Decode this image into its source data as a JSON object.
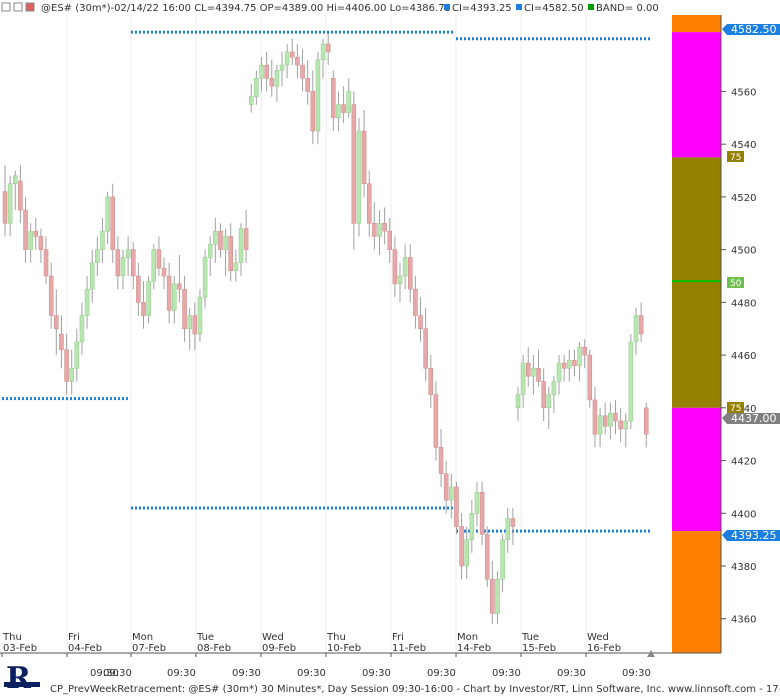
{
  "header": {
    "symbol_line": "@ES# (30m*)-02/14/22 16:00 CL=4394.75 OP=4389.00 Hi=4406.00 Lo=4386.75",
    "ci_upper": "CI=4393.25",
    "ci_lower": "CI=4582.50",
    "band": "BAND= 0.00"
  },
  "footer": {
    "status": "CP_PrevWeekRetracement: @ES# (30m*) 30 Minutes*, Day Session 09:30-16:00 - Chart by Investor/RT, Linn Software, Inc. www.linnsoft.com - 17-Fe"
  },
  "price_labels": {
    "top_level": "4582.50",
    "current": "4437.00",
    "bottom_level": "4393.25",
    "pct_75_upper": "75",
    "pct_50": "50",
    "pct_75_lower": "75"
  },
  "colors": {
    "up_candle": "#b8e6b0",
    "down_candle": "#e6a8a8",
    "dotted_level": "#1a7fe0",
    "band_orange": "#ff8000",
    "band_magenta": "#ff00ff",
    "band_olive": "#958000",
    "line_50": "#00c000",
    "current_label": "#808080"
  },
  "chart_data": {
    "type": "candlestick",
    "ylim": [
      4347,
      4589
    ],
    "y_ticks": [
      4360,
      4380,
      4400,
      4420,
      4440,
      4460,
      4480,
      4500,
      4520,
      4540,
      4560
    ],
    "x_labels": [
      {
        "day": "Thu",
        "date": "03-Feb"
      },
      {
        "day": "Fri",
        "date": "04-Feb"
      },
      {
        "day": "Mon",
        "date": "07-Feb"
      },
      {
        "day": "Tue",
        "date": "08-Feb"
      },
      {
        "day": "Wed",
        "date": "09-Feb"
      },
      {
        "day": "Thu",
        "date": "10-Feb"
      },
      {
        "day": "Fri",
        "date": "11-Feb"
      },
      {
        "day": "Mon",
        "date": "14-Feb"
      },
      {
        "day": "Tue",
        "date": "15-Feb"
      },
      {
        "day": "Wed",
        "date": "16-Feb"
      }
    ],
    "session_label": "09:30",
    "levels": [
      {
        "value": 4582.5,
        "from_day": 2,
        "to_day": 6
      },
      {
        "value": 4580.0,
        "from_day": 7,
        "to_day": 9
      },
      {
        "value": 4443.5,
        "from_day": 0,
        "to_day": 1
      },
      {
        "value": 4402.0,
        "from_day": 2,
        "to_day": 6
      },
      {
        "value": 4393.25,
        "from_day": 7,
        "to_day": 9
      }
    ],
    "band": {
      "segments": [
        {
          "from": 4582.5,
          "to": 4589,
          "color": "orange"
        },
        {
          "from": 4535,
          "to": 4582.5,
          "color": "magenta"
        },
        {
          "from": 4440,
          "to": 4535,
          "color": "olive"
        },
        {
          "from": 4393.25,
          "to": 4440,
          "color": "magenta"
        },
        {
          "from": 4347,
          "to": 4393.25,
          "color": "orange"
        }
      ],
      "line_50": 4488,
      "pct_75_upper": 4535,
      "pct_75_lower": 4440
    },
    "candles": [
      [
        4522,
        4532,
        4505,
        4510
      ],
      [
        4510,
        4528,
        4505,
        4525
      ],
      [
        4525,
        4530,
        4515,
        4528
      ],
      [
        4526,
        4532,
        4510,
        4515
      ],
      [
        4515,
        4520,
        4495,
        4500
      ],
      [
        4500,
        4510,
        4495,
        4507
      ],
      [
        4507,
        4512,
        4500,
        4505
      ],
      [
        4505,
        4508,
        4495,
        4500
      ],
      [
        4500,
        4505,
        4487,
        4490
      ],
      [
        4490,
        4495,
        4470,
        4475
      ],
      [
        4475,
        4485,
        4460,
        4470
      ],
      [
        4468,
        4475,
        4455,
        4462
      ],
      [
        4462,
        4468,
        4445,
        4450
      ],
      [
        4450,
        4462,
        4445,
        4455
      ],
      [
        4455,
        4470,
        4450,
        4465
      ],
      [
        4465,
        4480,
        4460,
        4475
      ],
      [
        4475,
        4490,
        4470,
        4485
      ],
      [
        4485,
        4500,
        4480,
        4495
      ],
      [
        4495,
        4505,
        4490,
        4500
      ],
      [
        4500,
        4512,
        4495,
        4507
      ],
      [
        4507,
        4522,
        4502,
        4520
      ],
      [
        4520,
        4525,
        4495,
        4500
      ],
      [
        4500,
        4505,
        4485,
        4490
      ],
      [
        4490,
        4500,
        4485,
        4497
      ],
      [
        4497,
        4505,
        4490,
        4500
      ],
      [
        4500,
        4503,
        4485,
        4490
      ],
      [
        4490,
        4495,
        4475,
        4480
      ],
      [
        4480,
        4488,
        4470,
        4475
      ],
      [
        4475,
        4490,
        4472,
        4488
      ],
      [
        4488,
        4502,
        4485,
        4500
      ],
      [
        4500,
        4505,
        4490,
        4493
      ],
      [
        4493,
        4497,
        4485,
        4490
      ],
      [
        4490,
        4495,
        4472,
        4477
      ],
      [
        4477,
        4490,
        4472,
        4487
      ],
      [
        4487,
        4498,
        4480,
        4485
      ],
      [
        4485,
        4490,
        4465,
        4470
      ],
      [
        4470,
        4478,
        4462,
        4475
      ],
      [
        4475,
        4480,
        4462,
        4468
      ],
      [
        4468,
        4485,
        4465,
        4482
      ],
      [
        4482,
        4500,
        4478,
        4497
      ],
      [
        4497,
        4505,
        4490,
        4502
      ],
      [
        4502,
        4512,
        4495,
        4507
      ],
      [
        4507,
        4510,
        4497,
        4500
      ],
      [
        4500,
        4508,
        4490,
        4505
      ],
      [
        4505,
        4510,
        4488,
        4492
      ],
      [
        4492,
        4500,
        4488,
        4495
      ],
      [
        4495,
        4510,
        4490,
        4508
      ],
      [
        4508,
        4515,
        4495,
        4500
      ],
      [
        4555,
        4563,
        4552,
        4558
      ],
      [
        4558,
        4568,
        4555,
        4565
      ],
      [
        4565,
        4573,
        4560,
        4570
      ],
      [
        4570,
        4575,
        4560,
        4565
      ],
      [
        4565,
        4572,
        4558,
        4562
      ],
      [
        4562,
        4570,
        4556,
        4568
      ],
      [
        4568,
        4575,
        4562,
        4570
      ],
      [
        4570,
        4578,
        4565,
        4575
      ],
      [
        4575,
        4580,
        4570,
        4573
      ],
      [
        4573,
        4578,
        4565,
        4570
      ],
      [
        4570,
        4576,
        4560,
        4565
      ],
      [
        4565,
        4572,
        4555,
        4560
      ],
      [
        4560,
        4568,
        4540,
        4545
      ],
      [
        4545,
        4575,
        4540,
        4572
      ],
      [
        4572,
        4580,
        4565,
        4578
      ],
      [
        4578,
        4582,
        4570,
        4575
      ],
      [
        4565,
        4568,
        4545,
        4550
      ],
      [
        4550,
        4560,
        4545,
        4555
      ],
      [
        4555,
        4562,
        4548,
        4552
      ],
      [
        4552,
        4565,
        4550,
        4560
      ],
      [
        4555,
        4560,
        4500,
        4510
      ],
      [
        4510,
        4550,
        4505,
        4545
      ],
      [
        4545,
        4553,
        4520,
        4525
      ],
      [
        4525,
        4530,
        4505,
        4510
      ],
      [
        4510,
        4518,
        4500,
        4505
      ],
      [
        4505,
        4515,
        4498,
        4510
      ],
      [
        4510,
        4516,
        4502,
        4507
      ],
      [
        4507,
        4512,
        4495,
        4500
      ],
      [
        4500,
        4505,
        4482,
        4487
      ],
      [
        4487,
        4495,
        4480,
        4490
      ],
      [
        4490,
        4502,
        4485,
        4497
      ],
      [
        4497,
        4502,
        4480,
        4485
      ],
      [
        4485,
        4490,
        4470,
        4475
      ],
      [
        4475,
        4482,
        4465,
        4470
      ],
      [
        4470,
        4478,
        4450,
        4455
      ],
      [
        4455,
        4460,
        4440,
        4445
      ],
      [
        4445,
        4450,
        4420,
        4425
      ],
      [
        4425,
        4432,
        4410,
        4415
      ],
      [
        4415,
        4420,
        4400,
        4405
      ],
      [
        4405,
        4415,
        4398,
        4410
      ],
      [
        4410,
        4412,
        4392,
        4395
      ],
      [
        4395,
        4400,
        4375,
        4380
      ],
      [
        4380,
        4395,
        4375,
        4390
      ],
      [
        4390,
        4405,
        4385,
        4400
      ],
      [
        4400,
        4412,
        4395,
        4408
      ],
      [
        4408,
        4412,
        4388,
        4392
      ],
      [
        4392,
        4395,
        4372,
        4375
      ],
      [
        4375,
        4382,
        4358,
        4362
      ],
      [
        4362,
        4378,
        4358,
        4375
      ],
      [
        4375,
        4392,
        4370,
        4390
      ],
      [
        4390,
        4402,
        4385,
        4398
      ],
      [
        4398,
        4402,
        4388,
        4395
      ],
      [
        4440,
        4448,
        4435,
        4445
      ],
      [
        4445,
        4460,
        4440,
        4457
      ],
      [
        4457,
        4463,
        4448,
        4452
      ],
      [
        4452,
        4460,
        4445,
        4455
      ],
      [
        4455,
        4462,
        4448,
        4450
      ],
      [
        4450,
        4455,
        4435,
        4440
      ],
      [
        4440,
        4448,
        4432,
        4445
      ],
      [
        4445,
        4452,
        4438,
        4450
      ],
      [
        4450,
        4460,
        4445,
        4457
      ],
      [
        4457,
        4460,
        4450,
        4455
      ],
      [
        4455,
        4462,
        4450,
        4458
      ],
      [
        4458,
        4462,
        4452,
        4456
      ],
      [
        4456,
        4465,
        4450,
        4463
      ],
      [
        4463,
        4466,
        4455,
        4460
      ],
      [
        4460,
        4462,
        4440,
        4443
      ],
      [
        4443,
        4448,
        4425,
        4430
      ],
      [
        4430,
        4440,
        4425,
        4437
      ],
      [
        4437,
        4442,
        4430,
        4433
      ],
      [
        4433,
        4442,
        4428,
        4438
      ],
      [
        4438,
        4443,
        4430,
        4435
      ],
      [
        4435,
        4440,
        4427,
        4432
      ],
      [
        4432,
        4438,
        4425,
        4435
      ],
      [
        4435,
        4468,
        4432,
        4465
      ],
      [
        4465,
        4478,
        4460,
        4475
      ],
      [
        4475,
        4480,
        4465,
        4468
      ],
      [
        4440,
        4442,
        4425,
        4430
      ]
    ]
  }
}
